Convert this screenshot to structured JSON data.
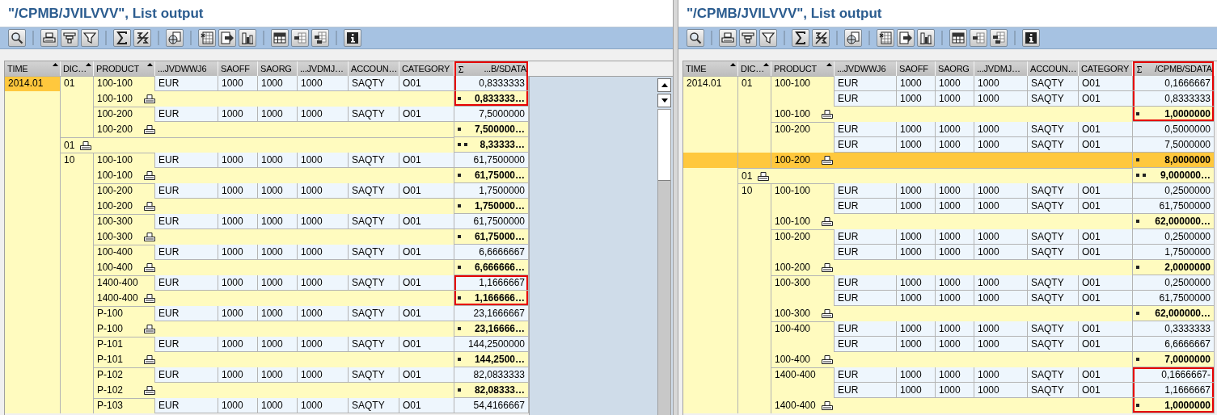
{
  "panels": [
    {
      "title": "\"/CPMB/JVILVVV\", List output",
      "vertical_scrollbar": true,
      "columns": [
        {
          "label": "TIME",
          "sorted": true,
          "totaled": false,
          "highlight": false
        },
        {
          "label": "DIC…",
          "sorted": true,
          "totaled": false,
          "highlight": false
        },
        {
          "label": "PRODUCT",
          "sorted": true,
          "totaled": false,
          "highlight": false
        },
        {
          "label": "...JVDWWJ6",
          "sorted": false,
          "totaled": false,
          "highlight": false
        },
        {
          "label": "SAOFF",
          "sorted": false,
          "totaled": false,
          "highlight": false
        },
        {
          "label": "SAORG",
          "sorted": false,
          "totaled": false,
          "highlight": false
        },
        {
          "label": "...JVDMJ…",
          "sorted": false,
          "totaled": false,
          "highlight": false
        },
        {
          "label": "ACCOUN…",
          "sorted": false,
          "totaled": false,
          "highlight": false
        },
        {
          "label": "CATEGORY",
          "sorted": false,
          "totaled": false,
          "highlight": false
        },
        {
          "label": "...B/SDATA",
          "sorted": false,
          "totaled": true,
          "highlight": true
        }
      ],
      "rows": [
        {
          "kind": "detail",
          "time": "2014.01",
          "time_selected": true,
          "dic": "01",
          "product": "100-100",
          "cells": [
            "EUR",
            "1000",
            "1000",
            "1000",
            "SAQTY",
            "O01"
          ],
          "value": "0,8333333",
          "highlight": true,
          "selected": false
        },
        {
          "kind": "subtotal",
          "product": "100-100",
          "value": "0,833333…",
          "highlight": true,
          "selected": false
        },
        {
          "kind": "detail",
          "product": "100-200",
          "cells": [
            "EUR",
            "1000",
            "1000",
            "1000",
            "SAQTY",
            "O01"
          ],
          "value": "7,5000000",
          "highlight": false,
          "selected": false
        },
        {
          "kind": "subtotal",
          "product": "100-200",
          "value": "7,500000…",
          "highlight": false,
          "selected": false
        },
        {
          "kind": "group_total",
          "dic": "01",
          "value": "8,33333…",
          "highlight": false,
          "selected": false
        },
        {
          "kind": "detail",
          "dic": "10",
          "product": "100-100",
          "cells": [
            "EUR",
            "1000",
            "1000",
            "1000",
            "SAQTY",
            "O01"
          ],
          "value": "61,7500000",
          "highlight": false,
          "selected": false
        },
        {
          "kind": "subtotal",
          "product": "100-100",
          "value": "61,75000…",
          "highlight": false,
          "selected": false
        },
        {
          "kind": "detail",
          "product": "100-200",
          "cells": [
            "EUR",
            "1000",
            "1000",
            "1000",
            "SAQTY",
            "O01"
          ],
          "value": "1,7500000",
          "highlight": false,
          "selected": false
        },
        {
          "kind": "subtotal",
          "product": "100-200",
          "value": "1,750000…",
          "highlight": false,
          "selected": false
        },
        {
          "kind": "detail",
          "product": "100-300",
          "cells": [
            "EUR",
            "1000",
            "1000",
            "1000",
            "SAQTY",
            "O01"
          ],
          "value": "61,7500000",
          "highlight": false,
          "selected": false
        },
        {
          "kind": "subtotal",
          "product": "100-300",
          "value": "61,75000…",
          "highlight": false,
          "selected": false
        },
        {
          "kind": "detail",
          "product": "100-400",
          "cells": [
            "EUR",
            "1000",
            "1000",
            "1000",
            "SAQTY",
            "O01"
          ],
          "value": "6,6666667",
          "highlight": false,
          "selected": false
        },
        {
          "kind": "subtotal",
          "product": "100-400",
          "value": "6,666666…",
          "highlight": false,
          "selected": false
        },
        {
          "kind": "detail",
          "product": "1400-400",
          "cells": [
            "EUR",
            "1000",
            "1000",
            "1000",
            "SAQTY",
            "O01"
          ],
          "value": "1,1666667",
          "highlight": true,
          "selected": false
        },
        {
          "kind": "subtotal",
          "product": "1400-400",
          "value": "1,166666…",
          "highlight": true,
          "selected": false
        },
        {
          "kind": "detail",
          "product": "P-100",
          "cells": [
            "EUR",
            "1000",
            "1000",
            "1000",
            "SAQTY",
            "O01"
          ],
          "value": "23,1666667",
          "highlight": false,
          "selected": false
        },
        {
          "kind": "subtotal",
          "product": "P-100",
          "value": "23,16666…",
          "highlight": false,
          "selected": false
        },
        {
          "kind": "detail",
          "product": "P-101",
          "cells": [
            "EUR",
            "1000",
            "1000",
            "1000",
            "SAQTY",
            "O01"
          ],
          "value": "144,2500000",
          "highlight": false,
          "selected": false
        },
        {
          "kind": "subtotal",
          "product": "P-101",
          "value": "144,2500…",
          "highlight": false,
          "selected": false
        },
        {
          "kind": "detail",
          "product": "P-102",
          "cells": [
            "EUR",
            "1000",
            "1000",
            "1000",
            "SAQTY",
            "O01"
          ],
          "value": "82,0833333",
          "highlight": false,
          "selected": false
        },
        {
          "kind": "subtotal",
          "product": "P-102",
          "value": "82,08333…",
          "highlight": false,
          "selected": false
        },
        {
          "kind": "detail",
          "product": "P-103",
          "cells": [
            "EUR",
            "1000",
            "1000",
            "1000",
            "SAQTY",
            "O01"
          ],
          "value": "54,4166667",
          "highlight": false,
          "selected": false
        }
      ]
    },
    {
      "title": "\"/CPMB/JVILVVV\", List output",
      "vertical_scrollbar": false,
      "columns": [
        {
          "label": "TIME",
          "sorted": true,
          "totaled": false,
          "highlight": false
        },
        {
          "label": "DIC…",
          "sorted": true,
          "totaled": false,
          "highlight": false
        },
        {
          "label": "PRODUCT",
          "sorted": true,
          "totaled": false,
          "highlight": false
        },
        {
          "label": "...JVDWWJ6",
          "sorted": false,
          "totaled": false,
          "highlight": false
        },
        {
          "label": "SAOFF",
          "sorted": false,
          "totaled": false,
          "highlight": false
        },
        {
          "label": "SAORG",
          "sorted": false,
          "totaled": false,
          "highlight": false
        },
        {
          "label": "...JVDMJ…",
          "sorted": false,
          "totaled": false,
          "highlight": false
        },
        {
          "label": "ACCOUN…",
          "sorted": false,
          "totaled": false,
          "highlight": false
        },
        {
          "label": "CATEGORY",
          "sorted": false,
          "totaled": false,
          "highlight": false
        },
        {
          "label": "/CPMB/SDATA",
          "sorted": false,
          "totaled": true,
          "highlight": true
        }
      ],
      "rows": [
        {
          "kind": "detail",
          "time": "2014.01",
          "time_selected": false,
          "dic": "01",
          "product": "100-100",
          "cells": [
            "EUR",
            "1000",
            "1000",
            "1000",
            "SAQTY",
            "O01"
          ],
          "value": "0,1666667",
          "highlight": true,
          "selected": false
        },
        {
          "kind": "detail",
          "cells": [
            "EUR",
            "1000",
            "1000",
            "1000",
            "SAQTY",
            "O01"
          ],
          "value": "0,8333333",
          "highlight": true,
          "selected": false
        },
        {
          "kind": "subtotal",
          "product": "100-100",
          "value": "1,0000000",
          "highlight": true,
          "selected": false
        },
        {
          "kind": "detail",
          "product": "100-200",
          "cells": [
            "EUR",
            "1000",
            "1000",
            "1000",
            "SAQTY",
            "O01"
          ],
          "value": "0,5000000",
          "highlight": false,
          "selected": false
        },
        {
          "kind": "detail",
          "cells": [
            "EUR",
            "1000",
            "1000",
            "1000",
            "SAQTY",
            "O01"
          ],
          "value": "7,5000000",
          "highlight": false,
          "selected": false
        },
        {
          "kind": "subtotal",
          "product": "100-200",
          "value": "8,0000000",
          "highlight": false,
          "selected": true
        },
        {
          "kind": "group_total",
          "dic": "01",
          "value": "9,000000…",
          "highlight": false,
          "selected": false
        },
        {
          "kind": "detail",
          "dic": "10",
          "product": "100-100",
          "cells": [
            "EUR",
            "1000",
            "1000",
            "1000",
            "SAQTY",
            "O01"
          ],
          "value": "0,2500000",
          "highlight": false,
          "selected": false
        },
        {
          "kind": "detail",
          "cells": [
            "EUR",
            "1000",
            "1000",
            "1000",
            "SAQTY",
            "O01"
          ],
          "value": "61,7500000",
          "highlight": false,
          "selected": false
        },
        {
          "kind": "subtotal",
          "product": "100-100",
          "value": "62,000000…",
          "highlight": false,
          "selected": false
        },
        {
          "kind": "detail",
          "product": "100-200",
          "cells": [
            "EUR",
            "1000",
            "1000",
            "1000",
            "SAQTY",
            "O01"
          ],
          "value": "0,2500000",
          "highlight": false,
          "selected": false
        },
        {
          "kind": "detail",
          "cells": [
            "EUR",
            "1000",
            "1000",
            "1000",
            "SAQTY",
            "O01"
          ],
          "value": "1,7500000",
          "highlight": false,
          "selected": false
        },
        {
          "kind": "subtotal",
          "product": "100-200",
          "value": "2,0000000",
          "highlight": false,
          "selected": false
        },
        {
          "kind": "detail",
          "product": "100-300",
          "cells": [
            "EUR",
            "1000",
            "1000",
            "1000",
            "SAQTY",
            "O01"
          ],
          "value": "0,2500000",
          "highlight": false,
          "selected": false
        },
        {
          "kind": "detail",
          "cells": [
            "EUR",
            "1000",
            "1000",
            "1000",
            "SAQTY",
            "O01"
          ],
          "value": "61,7500000",
          "highlight": false,
          "selected": false
        },
        {
          "kind": "subtotal",
          "product": "100-300",
          "value": "62,000000…",
          "highlight": false,
          "selected": false
        },
        {
          "kind": "detail",
          "product": "100-400",
          "cells": [
            "EUR",
            "1000",
            "1000",
            "1000",
            "SAQTY",
            "O01"
          ],
          "value": "0,3333333",
          "highlight": false,
          "selected": false
        },
        {
          "kind": "detail",
          "cells": [
            "EUR",
            "1000",
            "1000",
            "1000",
            "SAQTY",
            "O01"
          ],
          "value": "6,6666667",
          "highlight": false,
          "selected": false
        },
        {
          "kind": "subtotal",
          "product": "100-400",
          "value": "7,0000000",
          "highlight": false,
          "selected": false
        },
        {
          "kind": "detail",
          "product": "1400-400",
          "cells": [
            "EUR",
            "1000",
            "1000",
            "1000",
            "SAQTY",
            "O01"
          ],
          "value": "0,1666667-",
          "highlight": true,
          "selected": false
        },
        {
          "kind": "detail",
          "cells": [
            "EUR",
            "1000",
            "1000",
            "1000",
            "SAQTY",
            "O01"
          ],
          "value": "1,1666667",
          "highlight": true,
          "selected": false
        },
        {
          "kind": "subtotal",
          "product": "1400-400",
          "value": "1,0000000",
          "highlight": true,
          "selected": false
        }
      ]
    }
  ]
}
